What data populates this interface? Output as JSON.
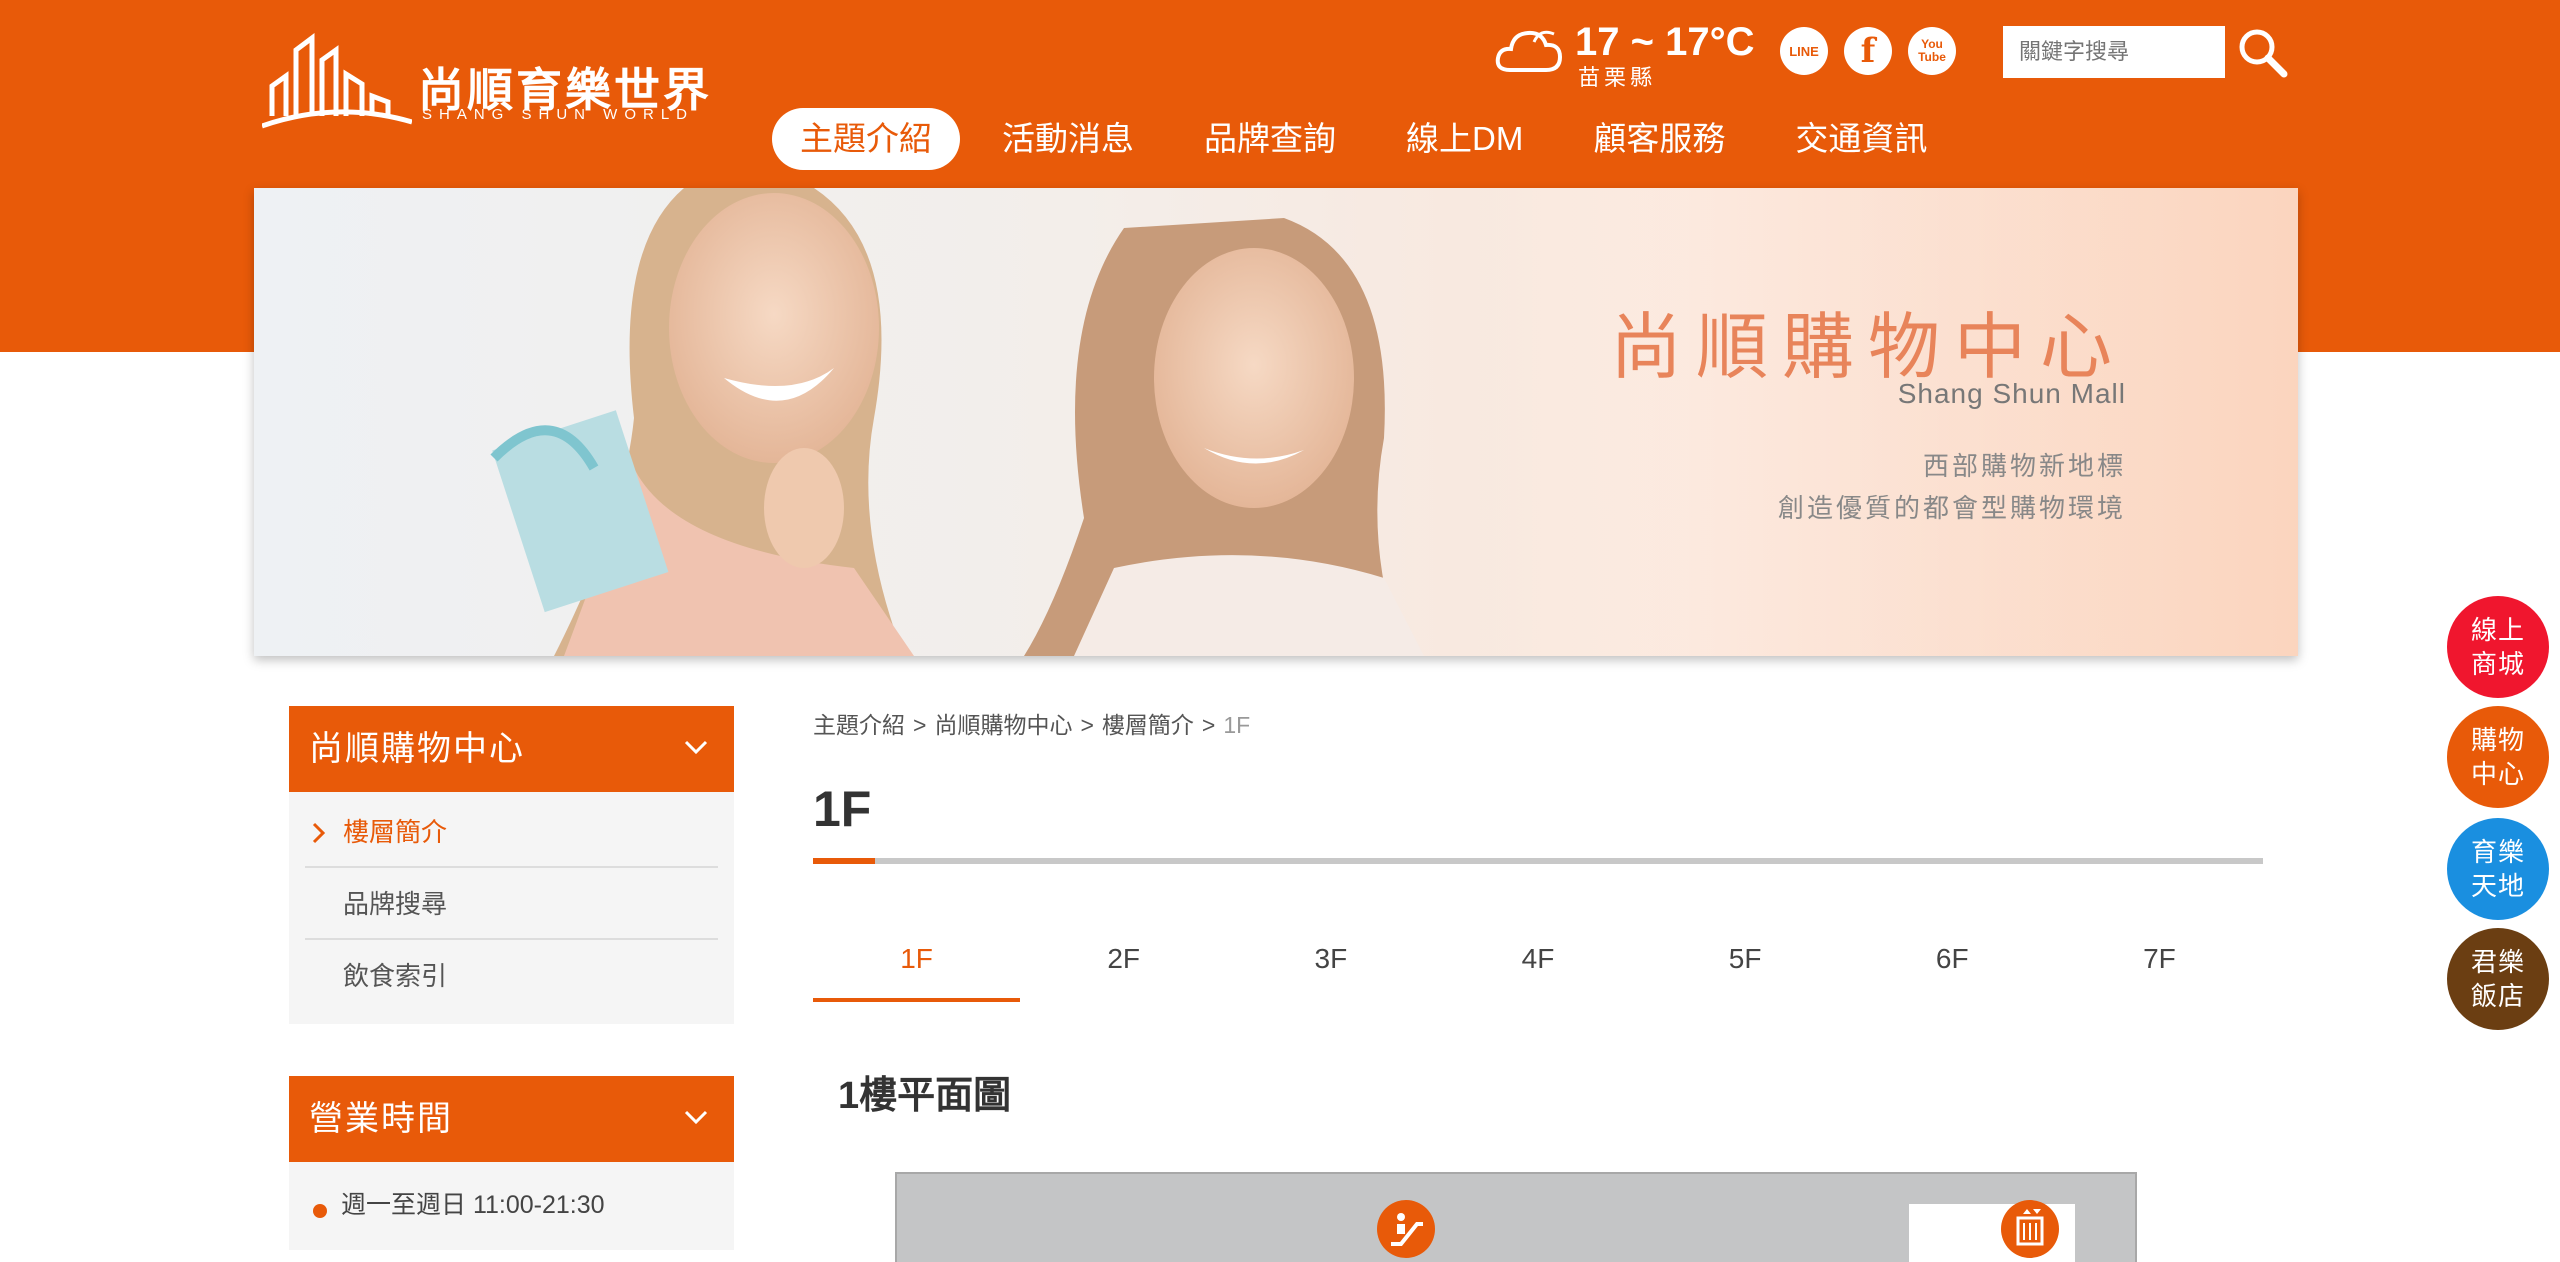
{
  "header": {
    "logo_title": "尚順育樂世界",
    "logo_subtitle": "SHANG SHUN WORLD",
    "weather": {
      "temp": "17 ~ 17°C",
      "location": "苗栗縣",
      "icon": "cloud-icon"
    },
    "social": [
      {
        "name": "line",
        "label": "LINE"
      },
      {
        "name": "facebook",
        "label": "f"
      },
      {
        "name": "youtube",
        "label": "You Tube"
      }
    ],
    "search": {
      "placeholder": "關鍵字搜尋"
    },
    "nav": [
      {
        "label": "主題介紹",
        "active": true
      },
      {
        "label": "活動消息"
      },
      {
        "label": "品牌查詢"
      },
      {
        "label": "線上DM"
      },
      {
        "label": "顧客服務"
      },
      {
        "label": "交通資訊"
      }
    ]
  },
  "banner": {
    "title": "尚順購物中心",
    "subtitle": "Shang Shun Mall",
    "line1": "西部購物新地標",
    "line2": "創造優質的都會型購物環境"
  },
  "sidebar": {
    "section1": {
      "title": "尚順購物中心",
      "items": [
        {
          "label": "樓層簡介",
          "active": true
        },
        {
          "label": "品牌搜尋"
        },
        {
          "label": "飲食索引"
        }
      ]
    },
    "section2": {
      "title": "營業時間",
      "hours": "週一至週日 11:00-21:30"
    }
  },
  "content": {
    "breadcrumb": [
      "主題介紹",
      "尚順購物中心",
      "樓層簡介",
      "1F"
    ],
    "page_title": "1F",
    "floor_tabs": [
      {
        "label": "1F",
        "active": true
      },
      {
        "label": "2F"
      },
      {
        "label": "3F"
      },
      {
        "label": "4F"
      },
      {
        "label": "5F"
      },
      {
        "label": "6F"
      },
      {
        "label": "7F"
      }
    ],
    "plan_heading": "1樓平面圖"
  },
  "float_buttons": [
    {
      "label": "線上商城",
      "color": "#f0162e"
    },
    {
      "label": "購物中心",
      "color": "#e85a09"
    },
    {
      "label": "育樂天地",
      "color": "#1a8fe0"
    },
    {
      "label": "君樂飯店",
      "color": "#6b3e12"
    }
  ],
  "colors": {
    "brand": "#e85a09"
  }
}
